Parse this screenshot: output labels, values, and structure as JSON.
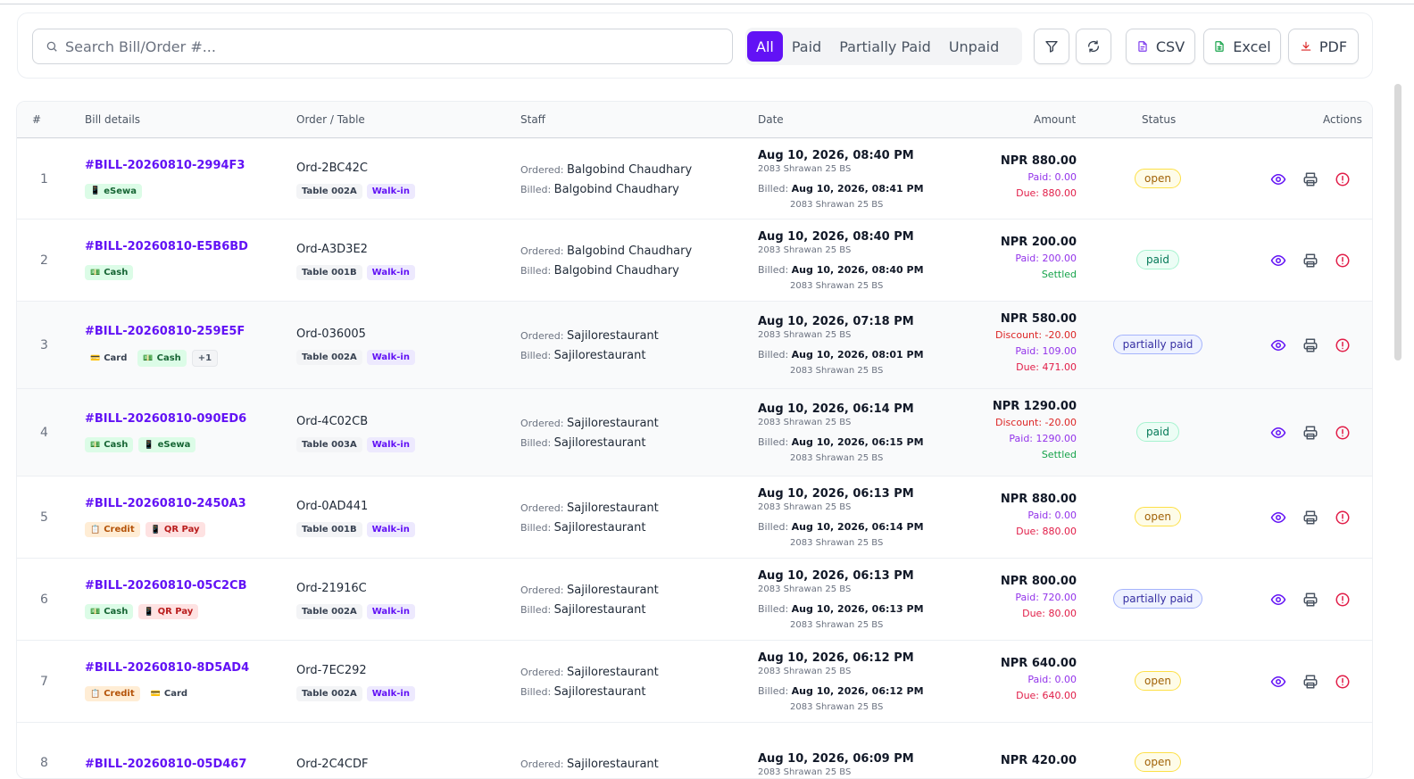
{
  "search": {
    "placeholder": "Search Bill/Order #..."
  },
  "filters": {
    "active": "All",
    "tabs": [
      "All",
      "Paid",
      "Partially Paid",
      "Unpaid"
    ]
  },
  "toolbar": {
    "filter_icon": "filter-icon",
    "refresh_icon": "refresh-icon",
    "csv_label": "CSV",
    "excel_label": "Excel",
    "pdf_label": "PDF"
  },
  "table": {
    "headers": {
      "num": "#",
      "bill": "Bill details",
      "order": "Order / Table",
      "staff": "Staff",
      "date": "Date",
      "amount": "Amount",
      "status": "Status",
      "actions": "Actions"
    },
    "labels": {
      "ordered": "Ordered:",
      "billed": "Billed:"
    },
    "rows": [
      {
        "num": "1",
        "bill": "#BILL-20260810-2994F3",
        "payments": [
          {
            "label": "eSewa",
            "style": "green",
            "icon": "📱"
          }
        ],
        "order": "Ord-2BC42C",
        "table": "Table 002A",
        "type": "Walk-in",
        "ordered_by": "Balgobind Chaudhary",
        "billed_by": "Balgobind Chaudhary",
        "date": "Aug 10, 2026, 08:40 PM",
        "date_bs": "2083 Shrawan 25 BS",
        "billed_date": "Aug 10, 2026, 08:41 PM",
        "billed_bs": "2083 Shrawan 25 BS",
        "amount": "NPR 880.00",
        "discount": "",
        "paid": "Paid: 0.00",
        "due": "Due: 880.00",
        "settled": "",
        "status": "open"
      },
      {
        "num": "2",
        "bill": "#BILL-20260810-E5B6BD",
        "payments": [
          {
            "label": "Cash",
            "style": "green",
            "icon": "💵"
          }
        ],
        "order": "Ord-A3D3E2",
        "table": "Table 001B",
        "type": "Walk-in",
        "ordered_by": "Balgobind Chaudhary",
        "billed_by": "Balgobind Chaudhary",
        "date": "Aug 10, 2026, 08:40 PM",
        "date_bs": "2083 Shrawan 25 BS",
        "billed_date": "Aug 10, 2026, 08:40 PM",
        "billed_bs": "2083 Shrawan 25 BS",
        "amount": "NPR 200.00",
        "discount": "",
        "paid": "Paid: 200.00",
        "due": "",
        "settled": "Settled",
        "status": "paid"
      },
      {
        "num": "3",
        "bill": "#BILL-20260810-259E5F",
        "payments": [
          {
            "label": "Card",
            "style": "plain",
            "icon": "💳"
          },
          {
            "label": "Cash",
            "style": "green",
            "icon": "💵"
          },
          {
            "label": "+1",
            "style": "gray",
            "icon": ""
          }
        ],
        "order": "Ord-036005",
        "table": "Table 002A",
        "type": "Walk-in",
        "ordered_by": "Sajilorestaurant",
        "billed_by": "Sajilorestaurant",
        "date": "Aug 10, 2026, 07:18 PM",
        "date_bs": "2083 Shrawan 25 BS",
        "billed_date": "Aug 10, 2026, 08:01 PM",
        "billed_bs": "2083 Shrawan 25 BS",
        "amount": "NPR 580.00",
        "discount": "Discount: -20.00",
        "paid": "Paid: 109.00",
        "due": "Due: 471.00",
        "settled": "",
        "status": "partially paid"
      },
      {
        "num": "4",
        "bill": "#BILL-20260810-090ED6",
        "payments": [
          {
            "label": "Cash",
            "style": "green",
            "icon": "💵"
          },
          {
            "label": "eSewa",
            "style": "green",
            "icon": "📱"
          }
        ],
        "order": "Ord-4C02CB",
        "table": "Table 003A",
        "type": "Walk-in",
        "ordered_by": "Sajilorestaurant",
        "billed_by": "Sajilorestaurant",
        "date": "Aug 10, 2026, 06:14 PM",
        "date_bs": "2083 Shrawan 25 BS",
        "billed_date": "Aug 10, 2026, 06:15 PM",
        "billed_bs": "2083 Shrawan 25 BS",
        "amount": "NPR 1290.00",
        "discount": "Discount: -20.00",
        "paid": "Paid: 1290.00",
        "due": "",
        "settled": "Settled",
        "status": "paid"
      },
      {
        "num": "5",
        "bill": "#BILL-20260810-2450A3",
        "payments": [
          {
            "label": "Credit",
            "style": "orange",
            "icon": "📋"
          },
          {
            "label": "QR Pay",
            "style": "red",
            "icon": "📱"
          }
        ],
        "order": "Ord-0AD441",
        "table": "Table 001B",
        "type": "Walk-in",
        "ordered_by": "Sajilorestaurant",
        "billed_by": "Sajilorestaurant",
        "date": "Aug 10, 2026, 06:13 PM",
        "date_bs": "2083 Shrawan 25 BS",
        "billed_date": "Aug 10, 2026, 06:14 PM",
        "billed_bs": "2083 Shrawan 25 BS",
        "amount": "NPR 880.00",
        "discount": "",
        "paid": "Paid: 0.00",
        "due": "Due: 880.00",
        "settled": "",
        "status": "open"
      },
      {
        "num": "6",
        "bill": "#BILL-20260810-05C2CB",
        "payments": [
          {
            "label": "Cash",
            "style": "green",
            "icon": "💵"
          },
          {
            "label": "QR Pay",
            "style": "red",
            "icon": "📱"
          }
        ],
        "order": "Ord-21916C",
        "table": "Table 002A",
        "type": "Walk-in",
        "ordered_by": "Sajilorestaurant",
        "billed_by": "Sajilorestaurant",
        "date": "Aug 10, 2026, 06:13 PM",
        "date_bs": "2083 Shrawan 25 BS",
        "billed_date": "Aug 10, 2026, 06:13 PM",
        "billed_bs": "2083 Shrawan 25 BS",
        "amount": "NPR 800.00",
        "discount": "",
        "paid": "Paid: 720.00",
        "due": "Due: 80.00",
        "settled": "",
        "status": "partially paid"
      },
      {
        "num": "7",
        "bill": "#BILL-20260810-8D5AD4",
        "payments": [
          {
            "label": "Credit",
            "style": "orange",
            "icon": "📋"
          },
          {
            "label": "Card",
            "style": "plain",
            "icon": "💳"
          }
        ],
        "order": "Ord-7EC292",
        "table": "Table 002A",
        "type": "Walk-in",
        "ordered_by": "Sajilorestaurant",
        "billed_by": "Sajilorestaurant",
        "date": "Aug 10, 2026, 06:12 PM",
        "date_bs": "2083 Shrawan 25 BS",
        "billed_date": "Aug 10, 2026, 06:12 PM",
        "billed_bs": "2083 Shrawan 25 BS",
        "amount": "NPR 640.00",
        "discount": "",
        "paid": "Paid: 0.00",
        "due": "Due: 640.00",
        "settled": "",
        "status": "open"
      },
      {
        "num": "8",
        "bill": "#BILL-20260810-05D467",
        "payments": [],
        "order": "Ord-2C4CDF",
        "table": "",
        "type": "",
        "ordered_by": "Sajilorestaurant",
        "billed_by": "",
        "date": "Aug 10, 2026, 06:09 PM",
        "date_bs": "2083 Shrawan 25 BS",
        "billed_date": "",
        "billed_bs": "",
        "amount": "NPR 420.00",
        "discount": "",
        "paid": "",
        "due": "",
        "settled": "",
        "status": "open"
      }
    ]
  },
  "colors": {
    "accent": "#6212f5",
    "due": "#e11d48",
    "settled": "#16a34a"
  }
}
